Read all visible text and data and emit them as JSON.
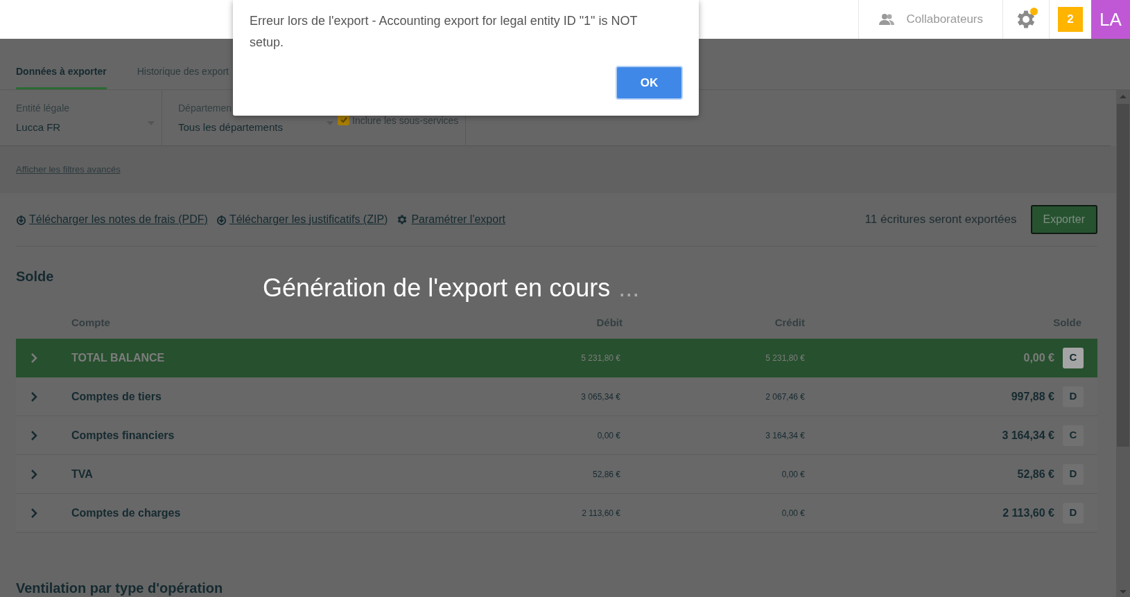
{
  "header": {
    "collaborators_label": "Collaborateurs",
    "settings_has_notification": true,
    "notification_count": "2",
    "avatar_initials": "LA"
  },
  "dialog": {
    "message": "Erreur lors de l'export - Accounting export for legal entity ID \"1\" is NOT setup.",
    "button": "OK"
  },
  "tabs": [
    {
      "label": "Données à exporter",
      "selected": true
    },
    {
      "label": "Historique des export",
      "selected": false
    }
  ],
  "filters": {
    "entity": {
      "label": "Entité légale",
      "value": "Lucca FR"
    },
    "department": {
      "label": "Départemen",
      "value": "Tous les départements"
    },
    "include_subservices": {
      "label": "Inclure les sous-services",
      "checked": true
    }
  },
  "advanced_filters_link": "Afficher les filtres avancés",
  "actions": [
    {
      "kind": "download",
      "label": "Télécharger les notes de frais (PDF)"
    },
    {
      "kind": "download",
      "label": "Télécharger les justificatifs (ZIP)"
    },
    {
      "kind": "settings",
      "label": "Paramétrer l'export"
    }
  ],
  "export_count": "11 écritures seront exportées",
  "export_button": "Exporter",
  "loading": {
    "text": "Génération de l'export en cours",
    "dots": "..."
  },
  "balance": {
    "title": "Solde",
    "columns": [
      "Compte",
      "Débit",
      "Crédit",
      "Solde"
    ],
    "rows": [
      {
        "account": "TOTAL BALANCE",
        "debit": "5 231,80 €",
        "credit": "5 231,80 €",
        "balance": "0,00 €",
        "side": "C",
        "highlighted": true
      },
      {
        "account": "Comptes de tiers",
        "debit": "3 065,34 €",
        "credit": "2 067,46 €",
        "balance": "997,88 €",
        "side": "D",
        "highlighted": false
      },
      {
        "account": "Comptes financiers",
        "debit": "0,00 €",
        "credit": "3 164,34 €",
        "balance": "3 164,34 €",
        "side": "C",
        "highlighted": false
      },
      {
        "account": "TVA",
        "debit": "52,86 €",
        "credit": "0,00 €",
        "balance": "52,86 €",
        "side": "D",
        "highlighted": false
      },
      {
        "account": "Comptes de charges",
        "debit": "2 113,60 €",
        "credit": "0,00 €",
        "balance": "2 113,60 €",
        "side": "D",
        "highlighted": false
      }
    ]
  },
  "breakdown_title": "Ventilation par type d'opération"
}
